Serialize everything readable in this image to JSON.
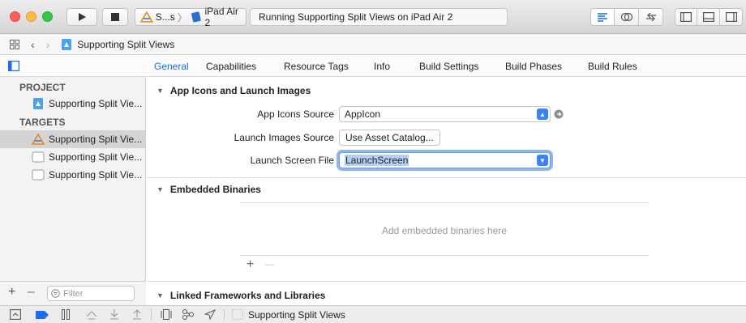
{
  "toolbar": {
    "scheme": {
      "target": "S...s",
      "separator": "〉",
      "device": "iPad Air 2"
    },
    "activity_text": "Running Supporting Split Views on iPad Air 2"
  },
  "jumpbar": {
    "project": "Supporting Split Views"
  },
  "tabs": [
    {
      "label": "General",
      "active": true
    },
    {
      "label": "Capabilities"
    },
    {
      "label": "Resource Tags"
    },
    {
      "label": "Info"
    },
    {
      "label": "Build Settings"
    },
    {
      "label": "Build Phases"
    },
    {
      "label": "Build Rules"
    }
  ],
  "sidebar": {
    "project_header": "PROJECT",
    "project_item": "Supporting Split Vie...",
    "targets_header": "TARGETS",
    "targets": [
      {
        "label": "Supporting Split Vie...",
        "icon": "app-target-icon",
        "selected": true
      },
      {
        "label": "Supporting Split Vie...",
        "icon": "test-bundle-icon"
      },
      {
        "label": "Supporting Split Vie...",
        "icon": "test-bundle-icon"
      }
    ],
    "filter_placeholder": "Filter"
  },
  "sections": {
    "app_icons": {
      "title": "App Icons and Launch Images",
      "app_icons_source_label": "App Icons Source",
      "app_icons_source_value": "AppIcon",
      "launch_images_source_label": "Launch Images Source",
      "launch_images_button": "Use Asset Catalog...",
      "launch_screen_file_label": "Launch Screen File",
      "launch_screen_file_value": "LaunchScreen"
    },
    "embedded": {
      "title": "Embedded Binaries",
      "empty_text": "Add embedded binaries here",
      "add": "+",
      "remove": "—"
    },
    "linked": {
      "title": "Linked Frameworks and Libraries"
    }
  },
  "debugbar": {
    "scheme_label": "Supporting Split Views"
  },
  "colors": {
    "accent": "#1d6cf0",
    "selection": "#b4cff3"
  }
}
